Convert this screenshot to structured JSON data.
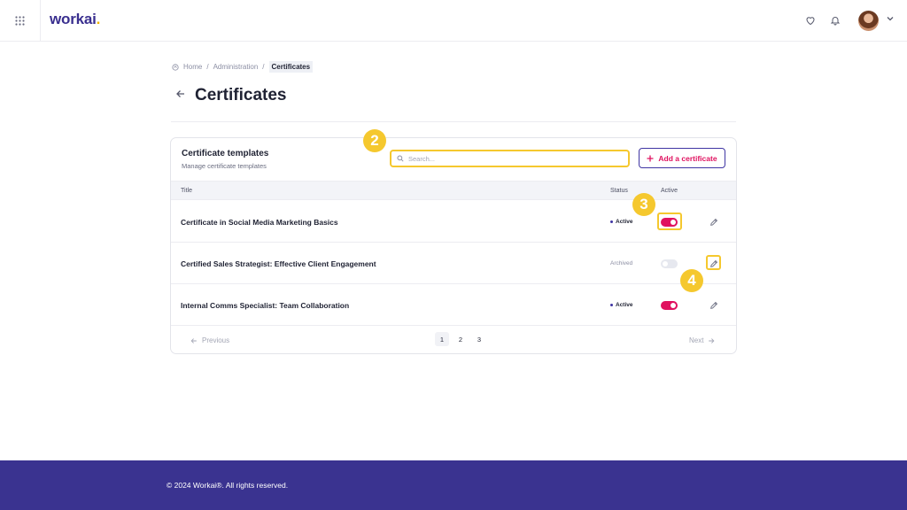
{
  "header": {
    "logo_text": "workai",
    "logo_dot": ".",
    "icons": [
      "apps-grid-icon",
      "heart-icon",
      "bell-icon",
      "avatar",
      "chevron-down-icon"
    ]
  },
  "breadcrumb": {
    "home": "Home",
    "sep": "/",
    "admin": "Administration",
    "current": "Certificates"
  },
  "page": {
    "title": "Certificates"
  },
  "card": {
    "title": "Certificate templates",
    "subtitle": "Manage certificate templates",
    "search_placeholder": "Search...",
    "add_button": "Add a certificate",
    "columns": {
      "title": "Title",
      "status": "Status",
      "active": "Active"
    },
    "rows": [
      {
        "title": "Certificate in Social Media Marketing Basics",
        "status": "Active",
        "active": true
      },
      {
        "title": "Certified Sales Strategist: Effective Client Engagement",
        "status": "Archived",
        "active": false
      },
      {
        "title": "Internal Comms Specialist: Team Collaboration",
        "status": "Active",
        "active": true
      }
    ],
    "pagination": {
      "prev": "Previous",
      "next": "Next",
      "pages": [
        "1",
        "2",
        "3"
      ],
      "current_page": "1"
    }
  },
  "steps": {
    "search": "2",
    "toggle": "3",
    "edit": "4"
  },
  "footer": {
    "text": "© 2024 Workai®. All rights reserved."
  },
  "colors": {
    "brand": "#3a3390",
    "accent": "#e0115f",
    "highlight": "#f5c82e"
  }
}
